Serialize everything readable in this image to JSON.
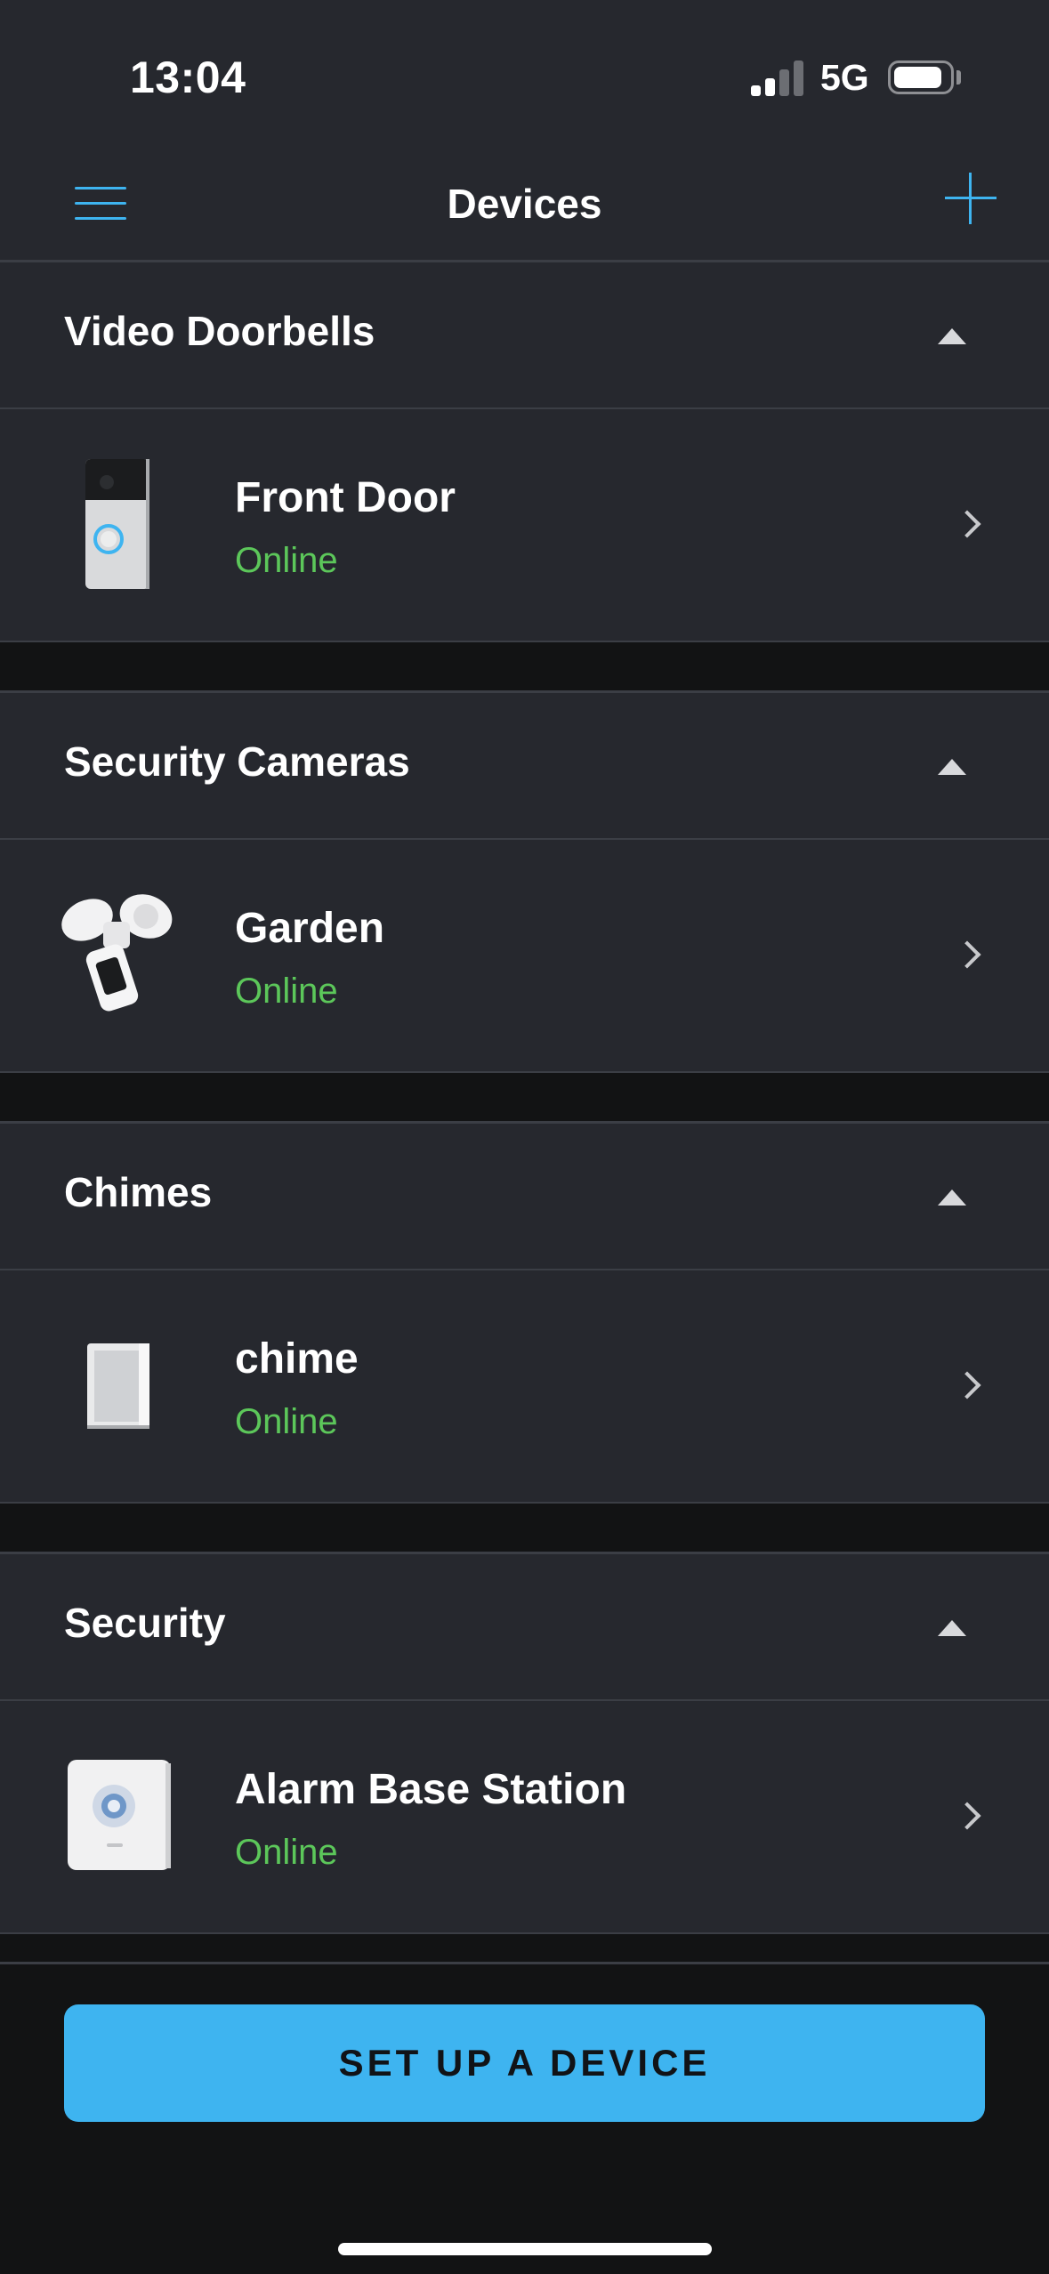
{
  "status_bar": {
    "time": "13:04",
    "network": "5G",
    "signal_bars_active": 2,
    "signal_bars_total": 4,
    "battery_level": 0.85
  },
  "nav": {
    "title": "Devices",
    "menu_icon": "hamburger-menu-icon",
    "add_icon": "plus-icon"
  },
  "sections": [
    {
      "title": "Video Doorbells",
      "device": {
        "name": "Front Door",
        "status": "Online",
        "icon": "doorbell-icon"
      }
    },
    {
      "title": "Security Cameras",
      "device": {
        "name": "Garden",
        "status": "Online",
        "icon": "floodlight-camera-icon"
      }
    },
    {
      "title": "Chimes",
      "device": {
        "name": "chime",
        "status": "Online",
        "icon": "chime-icon"
      }
    },
    {
      "title": "Security",
      "device": {
        "name": "Alarm Base Station",
        "status": "Online",
        "icon": "alarm-base-station-icon"
      }
    }
  ],
  "bottom": {
    "setup_button": "SET UP A DEVICE"
  },
  "colors": {
    "accent": "#3eb4f0",
    "online": "#5cc75a",
    "panel": "#26282e",
    "background": "#121314"
  }
}
